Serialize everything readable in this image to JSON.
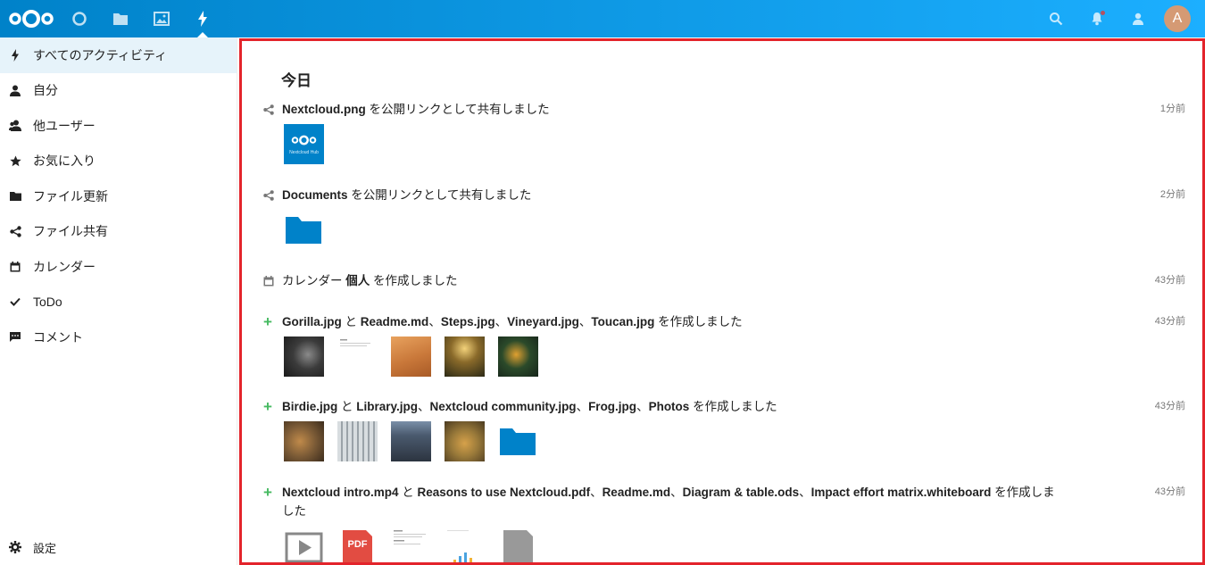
{
  "header": {
    "apps": [
      {
        "name": "dashboard-icon"
      },
      {
        "name": "files-icon"
      },
      {
        "name": "photos-icon"
      },
      {
        "name": "activity-icon",
        "active": true
      }
    ],
    "avatar_letter": "A"
  },
  "sidebar": {
    "items": [
      {
        "label": "すべてのアクティビティ",
        "icon": "lightning-icon",
        "active": true
      },
      {
        "label": "自分",
        "icon": "person-icon"
      },
      {
        "label": "他ユーザー",
        "icon": "people-icon"
      },
      {
        "label": "お気に入り",
        "icon": "star-icon"
      },
      {
        "label": "ファイル更新",
        "icon": "folder-icon"
      },
      {
        "label": "ファイル共有",
        "icon": "share-icon"
      },
      {
        "label": "カレンダー",
        "icon": "calendar-icon"
      },
      {
        "label": "ToDo",
        "icon": "checkmark-icon"
      },
      {
        "label": "コメント",
        "icon": "comment-icon"
      }
    ],
    "settings_label": "設定"
  },
  "main": {
    "day": "今日",
    "activities": [
      {
        "icon": "share-icon",
        "bold1": "Nextcloud.png",
        "rest": " を公開リンクとして共有しました",
        "time": "1分前"
      },
      {
        "icon": "share-icon",
        "bold1": "Documents",
        "rest": " を公開リンクとして共有しました",
        "time": "2分前"
      },
      {
        "icon": "calendar-icon",
        "pre": "カレンダー ",
        "bold1": "個人",
        "rest": " を作成しました",
        "time": "43分前"
      },
      {
        "icon": "plus-icon",
        "bold1": "Gorilla.jpg",
        "mid1": " と ",
        "bold2": "Readme.md",
        "sep1": "、",
        "bold3": "Steps.jpg",
        "sep2": "、",
        "bold4": "Vineyard.jpg",
        "sep3": "、",
        "bold5": "Toucan.jpg",
        "rest": " を作成しました",
        "time": "43分前"
      },
      {
        "icon": "plus-icon",
        "bold1": "Birdie.jpg",
        "mid1": " と ",
        "bold2": "Library.jpg",
        "sep1": "、",
        "bold3": "Nextcloud community.jpg",
        "sep2": "、",
        "bold4": "Frog.jpg",
        "sep3": "、",
        "bold5": "Photos",
        "rest": " を作成しました",
        "time": "43分前"
      },
      {
        "icon": "plus-icon",
        "bold1": "Nextcloud intro.mp4",
        "mid1": " と ",
        "bold2": "Reasons to use Nextcloud.pdf",
        "sep1": "、",
        "bold3": "Readme.md",
        "sep2": "、",
        "bold4": "Diagram & table.ods",
        "sep3": "、",
        "bold5": "Impact effort matrix.whiteboard",
        "rest": " を作成しました",
        "time": "43分前"
      }
    ],
    "nextcloud_thumb_caption": "Nextcloud Hub",
    "pdf_label": "PDF"
  },
  "colors": {
    "header_start": "#0082c9",
    "header_end": "#1cafff",
    "highlight_border": "#e3242b",
    "active_nav": "#e6f3fa",
    "folder": "#0082c9",
    "plus": "#46ba61"
  }
}
